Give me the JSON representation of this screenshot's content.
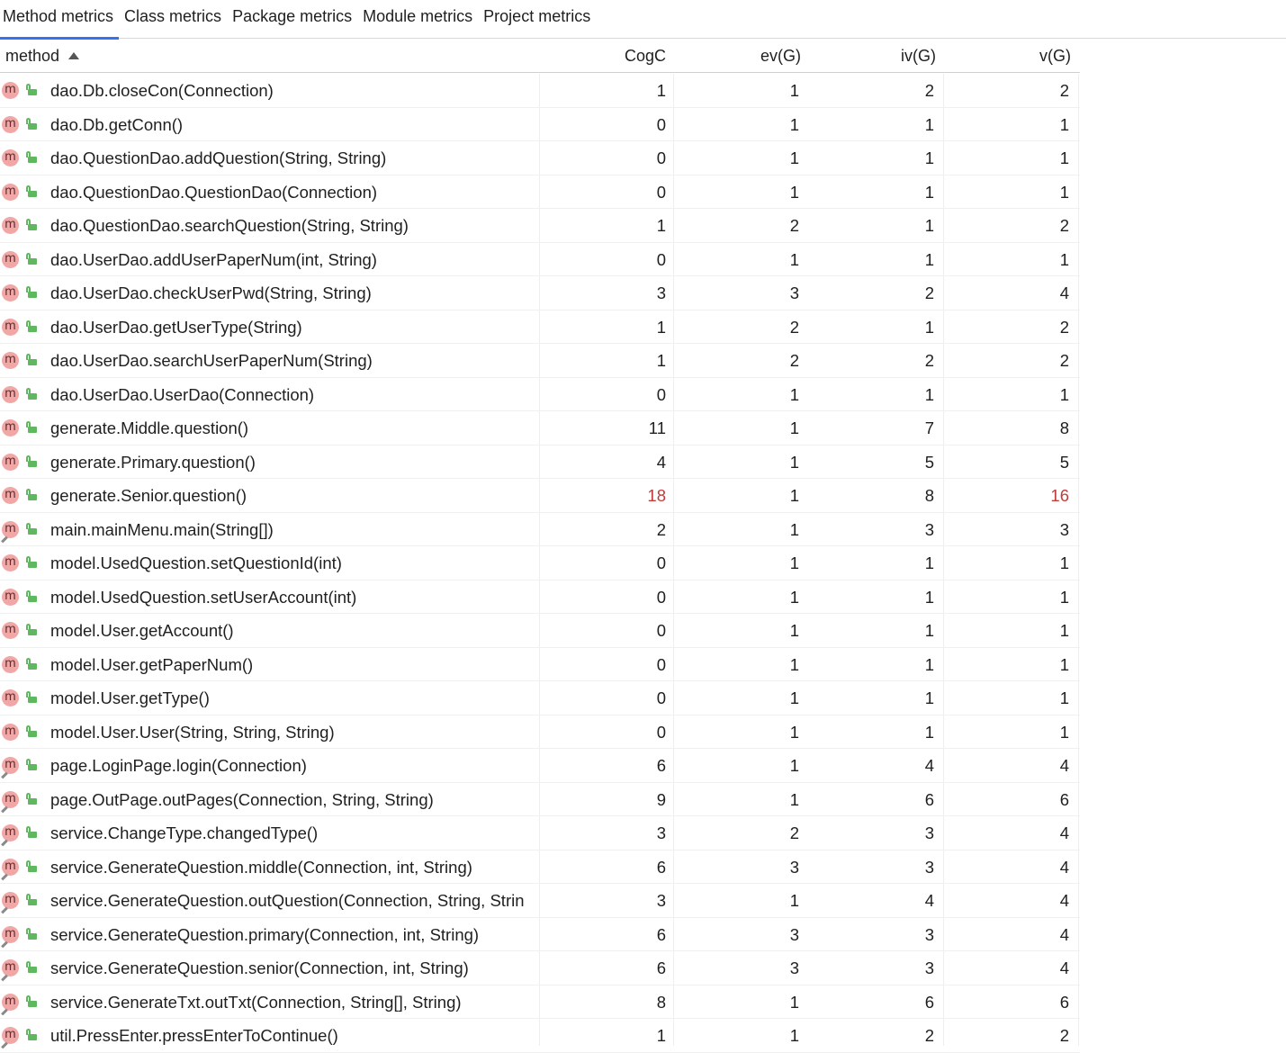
{
  "tabs": [
    "Method metrics",
    "Class metrics",
    "Package metrics",
    "Module metrics",
    "Project metrics"
  ],
  "active_tab": 0,
  "columns": [
    "method",
    "CogC",
    "ev(G)",
    "iv(G)",
    "v(G)"
  ],
  "highlight_color": "#c33a3a",
  "rows": [
    {
      "name": "dao.Db.closeCon(Connection)",
      "cogc": "1",
      "ev": "1",
      "iv": "2",
      "v": "2"
    },
    {
      "name": "dao.Db.getConn()",
      "cogc": "0",
      "ev": "1",
      "iv": "1",
      "v": "1"
    },
    {
      "name": "dao.QuestionDao.addQuestion(String, String)",
      "cogc": "0",
      "ev": "1",
      "iv": "1",
      "v": "1"
    },
    {
      "name": "dao.QuestionDao.QuestionDao(Connection)",
      "cogc": "0",
      "ev": "1",
      "iv": "1",
      "v": "1"
    },
    {
      "name": "dao.QuestionDao.searchQuestion(String, String)",
      "cogc": "1",
      "ev": "2",
      "iv": "1",
      "v": "2"
    },
    {
      "name": "dao.UserDao.addUserPaperNum(int, String)",
      "cogc": "0",
      "ev": "1",
      "iv": "1",
      "v": "1"
    },
    {
      "name": "dao.UserDao.checkUserPwd(String, String)",
      "cogc": "3",
      "ev": "3",
      "iv": "2",
      "v": "4"
    },
    {
      "name": "dao.UserDao.getUserType(String)",
      "cogc": "1",
      "ev": "2",
      "iv": "1",
      "v": "2"
    },
    {
      "name": "dao.UserDao.searchUserPaperNum(String)",
      "cogc": "1",
      "ev": "2",
      "iv": "2",
      "v": "2"
    },
    {
      "name": "dao.UserDao.UserDao(Connection)",
      "cogc": "0",
      "ev": "1",
      "iv": "1",
      "v": "1"
    },
    {
      "name": "generate.Middle.question()",
      "cogc": "11",
      "ev": "1",
      "iv": "7",
      "v": "8"
    },
    {
      "name": "generate.Primary.question()",
      "cogc": "4",
      "ev": "1",
      "iv": "5",
      "v": "5"
    },
    {
      "name": "generate.Senior.question()",
      "cogc": "18",
      "ev": "1",
      "iv": "8",
      "v": "16",
      "cogc_red": true,
      "v_red": true
    },
    {
      "name": "main.mainMenu.main(String[])",
      "cogc": "2",
      "ev": "1",
      "iv": "3",
      "v": "3",
      "ext": true
    },
    {
      "name": "model.UsedQuestion.setQuestionId(int)",
      "cogc": "0",
      "ev": "1",
      "iv": "1",
      "v": "1"
    },
    {
      "name": "model.UsedQuestion.setUserAccount(int)",
      "cogc": "0",
      "ev": "1",
      "iv": "1",
      "v": "1"
    },
    {
      "name": "model.User.getAccount()",
      "cogc": "0",
      "ev": "1",
      "iv": "1",
      "v": "1"
    },
    {
      "name": "model.User.getPaperNum()",
      "cogc": "0",
      "ev": "1",
      "iv": "1",
      "v": "1"
    },
    {
      "name": "model.User.getType()",
      "cogc": "0",
      "ev": "1",
      "iv": "1",
      "v": "1"
    },
    {
      "name": "model.User.User(String, String, String)",
      "cogc": "0",
      "ev": "1",
      "iv": "1",
      "v": "1"
    },
    {
      "name": "page.LoginPage.login(Connection)",
      "cogc": "6",
      "ev": "1",
      "iv": "4",
      "v": "4",
      "ext": true
    },
    {
      "name": "page.OutPage.outPages(Connection, String, String)",
      "cogc": "9",
      "ev": "1",
      "iv": "6",
      "v": "6",
      "ext": true
    },
    {
      "name": "service.ChangeType.changedType()",
      "cogc": "3",
      "ev": "2",
      "iv": "3",
      "v": "4",
      "ext": true
    },
    {
      "name": "service.GenerateQuestion.middle(Connection, int, String)",
      "cogc": "6",
      "ev": "3",
      "iv": "3",
      "v": "4",
      "ext": true
    },
    {
      "name": "service.GenerateQuestion.outQuestion(Connection, String, Strin",
      "cogc": "3",
      "ev": "1",
      "iv": "4",
      "v": "4",
      "ext": true
    },
    {
      "name": "service.GenerateQuestion.primary(Connection, int, String)",
      "cogc": "6",
      "ev": "3",
      "iv": "3",
      "v": "4",
      "ext": true
    },
    {
      "name": "service.GenerateQuestion.senior(Connection, int, String)",
      "cogc": "6",
      "ev": "3",
      "iv": "3",
      "v": "4",
      "ext": true
    },
    {
      "name": "service.GenerateTxt.outTxt(Connection, String[], String)",
      "cogc": "8",
      "ev": "1",
      "iv": "6",
      "v": "6",
      "ext": true
    },
    {
      "name": "util.PressEnter.pressEnterToContinue()",
      "cogc": "1",
      "ev": "1",
      "iv": "2",
      "v": "2",
      "ext": true
    }
  ]
}
